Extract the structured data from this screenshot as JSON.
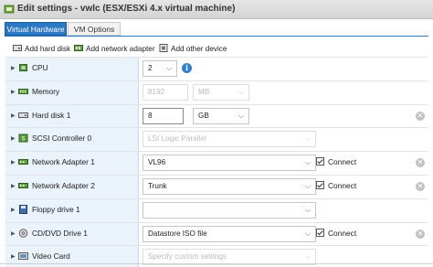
{
  "title": "Edit settings - vwlc (ESX/ESXi 4.x virtual machine)",
  "tabs": [
    {
      "label": "Virtual Hardware"
    },
    {
      "label": "VM Options"
    }
  ],
  "toolbar": {
    "add_hard_disk": "Add hard disk",
    "add_network_adapter": "Add network adapter",
    "add_other_device": "Add other device"
  },
  "rows": [
    {
      "label": "CPU",
      "value": "2",
      "icon": "cpu-icon"
    },
    {
      "label": "Memory",
      "value": "8192",
      "unit": "MB",
      "icon": "memory-icon"
    },
    {
      "label": "Hard disk 1",
      "value": "8",
      "unit": "GB",
      "icon": "hard-disk-icon"
    },
    {
      "label": "SCSI Controller 0",
      "value": "LSI Logic Parallel",
      "icon": "scsi-icon"
    },
    {
      "label": "Network Adapter 1",
      "value": "VL96",
      "connect_label": "Connect",
      "icon": "network-icon"
    },
    {
      "label": "Network Adapter 2",
      "value": "Trunk",
      "connect_label": "Connect",
      "icon": "network-icon"
    },
    {
      "label": "Floppy drive 1",
      "value": "",
      "icon": "floppy-icon"
    },
    {
      "label": "CD/DVD Drive 1",
      "value": "Datastore ISO file",
      "connect_label": "Connect",
      "icon": "cd-icon"
    },
    {
      "label": "Video Card",
      "value": "Specify custom settings",
      "icon": "video-card-icon"
    }
  ],
  "colors": {
    "accent": "#2b78c5",
    "label_bg": "#eaf3fb"
  }
}
